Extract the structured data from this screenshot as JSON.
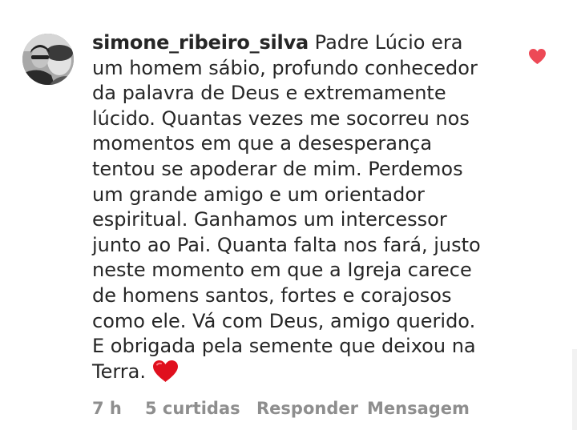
{
  "comment": {
    "username": "simone_ribeiro_silva",
    "lines": [
      "Padre Lúcio era",
      "um homem sábio, profundo conhecedor",
      "da palavra de Deus e extremamente",
      "lúcido. Quantas vezes me socorreu nos",
      "momentos em que a desesperança",
      "tentou se apoderar de mim. Perdemos",
      "um grande amigo e um orientador",
      "espiritual. Ganhamos um intercessor",
      "junto ao Pai. Quanta falta nos fará, justo",
      "neste momento em que a Igreja carece",
      "de homens santos, fortes e corajosos",
      "como ele. Vá com Deus, amigo querido.",
      "E obrigada pela semente que deixou na",
      "Terra."
    ],
    "end_emoji": "red-heart-emoji"
  },
  "meta": {
    "time": "7 h",
    "likes": "5 curtidas",
    "reply": "Responder",
    "message": "Mensagem"
  },
  "icons": {
    "avatar": "profile-photo",
    "like": "heart-icon"
  },
  "colors": {
    "text": "#262626",
    "meta": "#8e8e8e",
    "like_heart": "#ed4956",
    "emoji_heart": "#e0101e"
  }
}
